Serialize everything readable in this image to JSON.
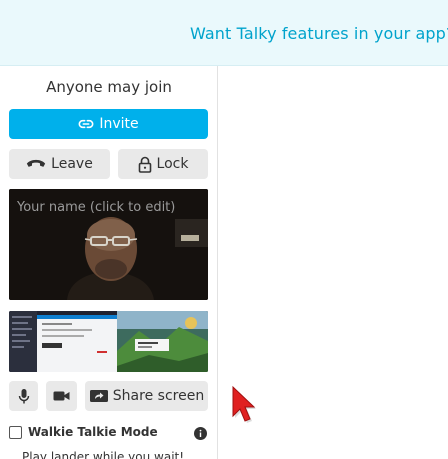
{
  "banner": {
    "text": "Want Talky features in your app? C"
  },
  "sidebar": {
    "room_status": "Anyone may join",
    "invite_label": "Invite",
    "leave_label": "Leave",
    "lock_label": "Lock",
    "video": {
      "name_placeholder": "Your name (click to edit)"
    },
    "controls": {
      "share_label": "Share screen"
    },
    "walkie_label": "Walkie Talkie Mode",
    "walkie_checked": false,
    "lander_text": "Play lander while you wait!"
  },
  "colors": {
    "accent": "#00b0eb",
    "banner_bg": "#eaf9fc",
    "banner_text": "#00a3cc",
    "button_bg": "#e9e9e9",
    "cursor": "#e02020"
  },
  "icons": {
    "invite": "link-icon",
    "leave": "phone-hangup-icon",
    "lock": "lock-icon",
    "mic": "microphone-icon",
    "camera": "video-camera-icon",
    "share": "screen-share-icon",
    "info": "info-icon",
    "cursor": "mouse-cursor-icon"
  }
}
